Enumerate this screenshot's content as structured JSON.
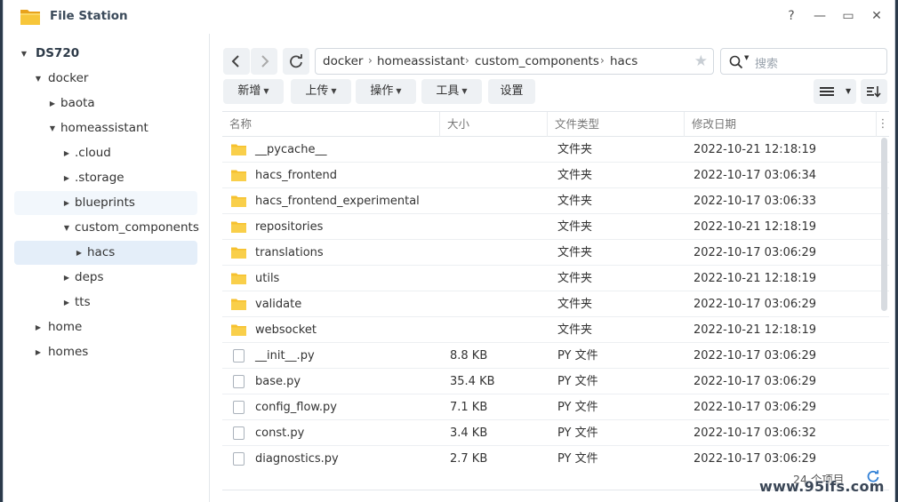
{
  "window": {
    "title": "File Station",
    "controls": {
      "help": "?",
      "minimize": "—",
      "maximize": "▭",
      "close": "✕"
    }
  },
  "sidebar": {
    "items": [
      {
        "label": "DS720",
        "expanded": true
      },
      {
        "label": "docker",
        "expanded": true
      },
      {
        "label": "baota",
        "expanded": false
      },
      {
        "label": "homeassistant",
        "expanded": true
      },
      {
        "label": ".cloud",
        "expanded": false
      },
      {
        "label": ".storage",
        "expanded": false
      },
      {
        "label": "blueprints",
        "expanded": false
      },
      {
        "label": "custom_components",
        "expanded": true
      },
      {
        "label": "hacs",
        "expanded": false,
        "selected": true
      },
      {
        "label": "deps",
        "expanded": false
      },
      {
        "label": "tts",
        "expanded": false
      },
      {
        "label": "home",
        "expanded": false
      },
      {
        "label": "homes",
        "expanded": false
      }
    ]
  },
  "toolbar": {
    "path": [
      "docker",
      "homeassistant",
      "custom_components",
      "hacs"
    ],
    "search_placeholder": "搜索",
    "buttons": {
      "new": "新增",
      "upload": "上传",
      "action": "操作",
      "tools": "工具",
      "settings": "设置"
    }
  },
  "table": {
    "columns": {
      "name": "名称",
      "size": "大小",
      "type": "文件类型",
      "modified": "修改日期"
    },
    "rows": [
      {
        "name": "__pycache__",
        "size": "",
        "type": "文件夹",
        "modified": "2022-10-21 12:18:19",
        "kind": "folder"
      },
      {
        "name": "hacs_frontend",
        "size": "",
        "type": "文件夹",
        "modified": "2022-10-17 03:06:34",
        "kind": "folder"
      },
      {
        "name": "hacs_frontend_experimental",
        "size": "",
        "type": "文件夹",
        "modified": "2022-10-17 03:06:33",
        "kind": "folder"
      },
      {
        "name": "repositories",
        "size": "",
        "type": "文件夹",
        "modified": "2022-10-21 12:18:19",
        "kind": "folder"
      },
      {
        "name": "translations",
        "size": "",
        "type": "文件夹",
        "modified": "2022-10-17 03:06:29",
        "kind": "folder"
      },
      {
        "name": "utils",
        "size": "",
        "type": "文件夹",
        "modified": "2022-10-21 12:18:19",
        "kind": "folder"
      },
      {
        "name": "validate",
        "size": "",
        "type": "文件夹",
        "modified": "2022-10-17 03:06:29",
        "kind": "folder"
      },
      {
        "name": "websocket",
        "size": "",
        "type": "文件夹",
        "modified": "2022-10-21 12:18:19",
        "kind": "folder"
      },
      {
        "name": "__init__.py",
        "size": "8.8 KB",
        "type": "PY 文件",
        "modified": "2022-10-17 03:06:29",
        "kind": "file"
      },
      {
        "name": "base.py",
        "size": "35.4 KB",
        "type": "PY 文件",
        "modified": "2022-10-17 03:06:29",
        "kind": "file"
      },
      {
        "name": "config_flow.py",
        "size": "7.1 KB",
        "type": "PY 文件",
        "modified": "2022-10-17 03:06:29",
        "kind": "file"
      },
      {
        "name": "const.py",
        "size": "3.4 KB",
        "type": "PY 文件",
        "modified": "2022-10-17 03:06:32",
        "kind": "file"
      },
      {
        "name": "diagnostics.py",
        "size": "2.7 KB",
        "type": "PY 文件",
        "modified": "2022-10-17 03:06:29",
        "kind": "file"
      }
    ]
  },
  "status": {
    "count": "24 个项目"
  },
  "watermark": "www.95ifs.com",
  "colors": {
    "folder": "#f6c12f",
    "accent": "#2f7fd6",
    "selection": "#e4eef9"
  }
}
